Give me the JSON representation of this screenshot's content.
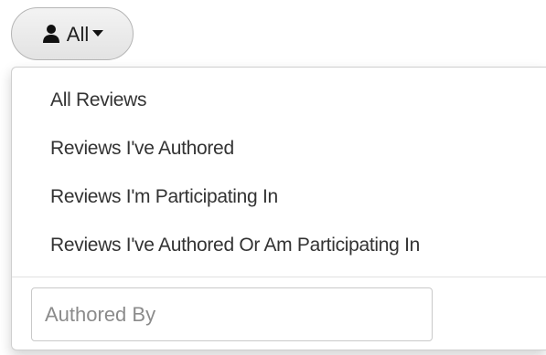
{
  "filter_button": {
    "label": "All",
    "icon": "user-icon",
    "caret_icon": "caret-down-icon"
  },
  "menu": {
    "items": [
      {
        "label": "All Reviews"
      },
      {
        "label": "Reviews I've Authored"
      },
      {
        "label": "Reviews I'm Participating In"
      },
      {
        "label": "Reviews I've Authored Or Am Participating In"
      }
    ],
    "authored_by": {
      "placeholder": "Authored By",
      "value": ""
    }
  },
  "colors": {
    "button_border": "#b5b5b5",
    "menu_text": "#333333",
    "placeholder": "#8b8b8b"
  }
}
